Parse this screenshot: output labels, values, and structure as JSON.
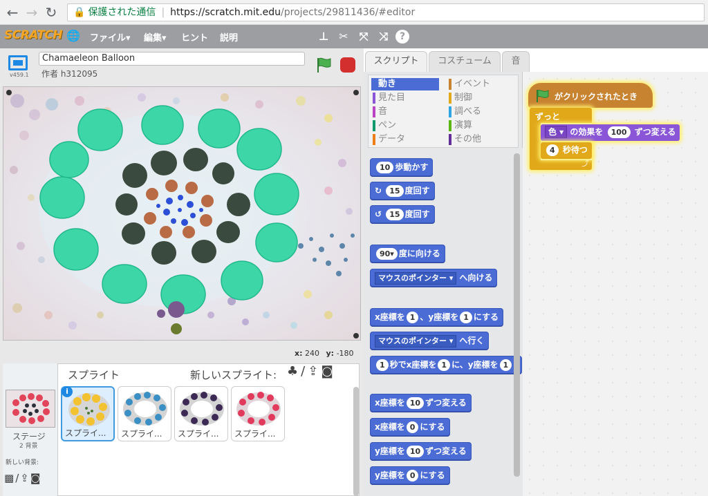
{
  "browser": {
    "secure_label": "保護された通信",
    "url_host": "https://scratch.mit.edu",
    "url_path": "/projects/29811436/#editor"
  },
  "menubar": {
    "logo": "SCRATCH",
    "file": "ファイル▾",
    "edit": "編集▾",
    "hint": "ヒント",
    "about": "説明"
  },
  "project": {
    "title": "Chamaeleon Balloon",
    "author": "作者 h312095",
    "version": "v459.1"
  },
  "stage": {
    "x_label": "x:",
    "x_value": "240",
    "y_label": "y:",
    "y_value": "-180"
  },
  "sprites_panel": {
    "header": "スプライト",
    "new_sprite": "新しいスプライト:",
    "stage_label": "ステージ",
    "backdrop_count": "2 背景",
    "new_backdrop": "新しい背景:",
    "sprites": [
      {
        "label": "スプライ..."
      },
      {
        "label": "スプライ..."
      },
      {
        "label": "スプライ..."
      },
      {
        "label": "スプライ..."
      }
    ]
  },
  "tabs": [
    "スクリプト",
    "コスチューム",
    "音"
  ],
  "categories": [
    {
      "label": "動き",
      "color": "#4a6cd4"
    },
    {
      "label": "見た目",
      "color": "#8a55d7"
    },
    {
      "label": "音",
      "color": "#bb42c3"
    },
    {
      "label": "ペン",
      "color": "#0e9a6c"
    },
    {
      "label": "データ",
      "color": "#ee7d16"
    },
    {
      "label": "イベント",
      "color": "#c88330"
    },
    {
      "label": "制御",
      "color": "#e1a91a"
    },
    {
      "label": "調べる",
      "color": "#2ca5e2"
    },
    {
      "label": "演算",
      "color": "#5cb712"
    },
    {
      "label": "その他",
      "color": "#632d99"
    }
  ],
  "blocks": {
    "move": {
      "num": "10",
      "text": "歩動かす"
    },
    "turn_right": {
      "num": "15",
      "text": "度回す"
    },
    "turn_left": {
      "num": "15",
      "text": "度回す"
    },
    "point_dir": {
      "num": "90▾",
      "text": "度に向ける"
    },
    "point_towards": {
      "drop": "マウスのポインター ▾",
      "text": "へ向ける"
    },
    "goto_xy": {
      "a": "x座標を",
      "x": "1",
      "b": "、y座標を",
      "y": "1",
      "c": "にする"
    },
    "goto": {
      "drop": "マウスのポインター ▾",
      "text": "へ行く"
    },
    "glide": {
      "t": "1",
      "a": "秒でx座標を",
      "x": "1",
      "b": "に、y座標を",
      "y": "1"
    },
    "change_x": {
      "a": "x座標を",
      "n": "10",
      "b": "ずつ変える"
    },
    "set_x": {
      "a": "x座標を",
      "n": "0",
      "b": "にする"
    },
    "change_y": {
      "a": "y座標を",
      "n": "10",
      "b": "ずつ変える"
    },
    "set_y": {
      "a": "y座標を",
      "n": "0",
      "b": "にする"
    }
  },
  "script": {
    "hat": "がクリックされたとき",
    "forever": "ずっと",
    "effect_drop": "色 ▾",
    "effect_text": "の効果を",
    "effect_num": "100",
    "effect_tail": "ずつ変える",
    "wait_num": "4",
    "wait_text": "秒待つ"
  }
}
